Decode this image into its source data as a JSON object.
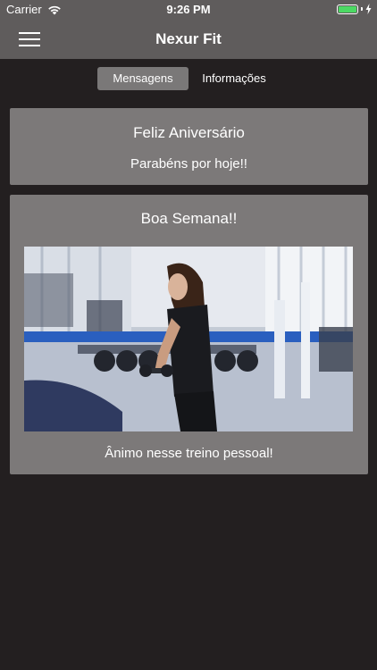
{
  "status_bar": {
    "carrier": "Carrier",
    "time": "9:26 PM",
    "battery_level": 1.0,
    "battery_color": "#4cd964"
  },
  "nav": {
    "title": "Nexur Fit",
    "menu_icon": "hamburger-icon"
  },
  "segments": {
    "items": [
      "Mensagens",
      "Informações"
    ],
    "selected": "Mensagens"
  },
  "messages": [
    {
      "title": "Feliz Aniversário",
      "body": "Parabéns por hoje!!"
    },
    {
      "title": "Boa Semana!!",
      "image": "gym-photo-woman-lifting-dumbbell",
      "body": "Ânimo nesse treino pessoal!"
    }
  ],
  "colors": {
    "background": "#231f20",
    "bar": "#5f5c5c",
    "card": "#7c7979",
    "segment_active": "#7a7878"
  }
}
